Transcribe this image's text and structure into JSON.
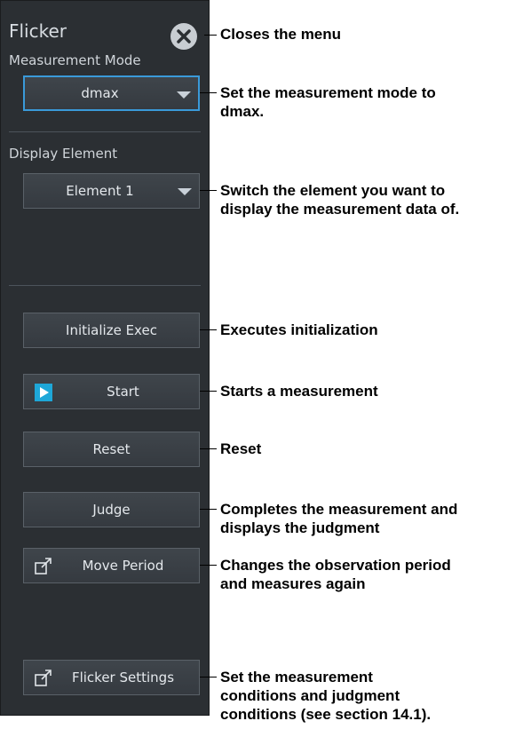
{
  "panel": {
    "title": "Flicker",
    "measurement_mode_label": "Measurement Mode",
    "measurement_mode_value": "dmax",
    "display_element_label": "Display Element",
    "display_element_value": "Element 1",
    "initialize_label": "Initialize Exec",
    "start_label": "Start",
    "reset_label": "Reset",
    "judge_label": "Judge",
    "move_period_label": "Move Period",
    "flicker_settings_label": "Flicker Settings"
  },
  "callouts": {
    "close": "Closes the menu",
    "mode_line1": "Set the measurement mode to",
    "mode_line2": "dmax.",
    "element_line1": "Switch the element you want to",
    "element_line2": "display the measurement data of.",
    "initialize": "Executes initialization",
    "start": "Starts a measurement",
    "reset": "Reset",
    "judge_line1": "Completes the measurement and",
    "judge_line2": "displays the judgment",
    "move_line1": "Changes the observation period",
    "move_line2": "and measures again",
    "settings_line1": "Set the measurement",
    "settings_line2": "conditions and judgment",
    "settings_line3": "conditions (see section 14.1)."
  },
  "colors": {
    "panel_bg": "#2b2f33",
    "selected_border": "#3a9ad9",
    "start_icon": "#1ea7d8"
  }
}
